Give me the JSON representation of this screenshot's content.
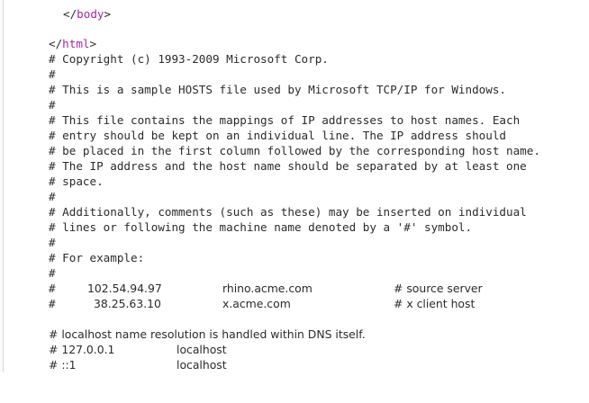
{
  "closing_tags": {
    "body": {
      "open": "</",
      "name": "body",
      "close": ">"
    },
    "html": {
      "open": "</",
      "name": "html",
      "close": ">"
    }
  },
  "colors": {
    "tag": "#a626a4",
    "text": "#2b2b2b"
  },
  "comment_lines": [
    "# Copyright (c) 1993-2009 Microsoft Corp.",
    "#",
    "# This is a sample HOSTS file used by Microsoft TCP/IP for Windows.",
    "#",
    "# This file contains the mappings of IP addresses to host names. Each",
    "# entry should be kept on an individual line. The IP address should",
    "# be placed in the first column followed by the corresponding host name.",
    "# The IP address and the host name should be separated by at least one",
    "# space.",
    "#",
    "# Additionally, comments (such as these) may be inserted on individual",
    "# lines or following the machine name denoted by a '#' symbol.",
    "#",
    "# For example:",
    "#"
  ],
  "examples": [
    {
      "hash": "#",
      "ip": "102.54.94.97",
      "host": "rhino.acme.com",
      "comment": "# source server"
    },
    {
      "hash": "#",
      "ip": "38.25.63.10",
      "host": "x.acme.com",
      "comment": "# x client host"
    }
  ],
  "localhost_note": "# localhost name resolution is handled within DNS itself.",
  "localhost_entries": [
    {
      "ip": "# 127.0.0.1",
      "host": "localhost"
    },
    {
      "ip": "# ::1",
      "host": "localhost"
    }
  ]
}
